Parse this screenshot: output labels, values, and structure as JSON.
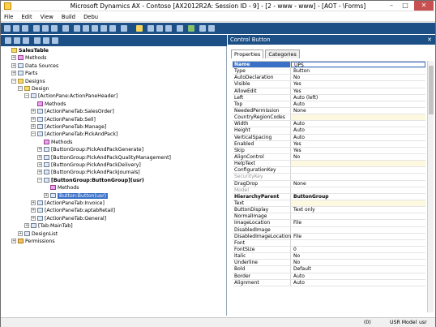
{
  "window": {
    "title": "Microsoft Dynamics AX - Contoso [AX2012R2A: Session ID - 9] - [2 - www - www] - [AOT - \\Forms]",
    "minimize": "–",
    "maximize": "□",
    "close": "✕"
  },
  "menu": [
    "File",
    "Edit",
    "View",
    "Build",
    "Debu"
  ],
  "tree": [
    {
      "label": "SalesTable",
      "icon": "form-icon",
      "bold": true,
      "indent": 0,
      "expander": ""
    },
    {
      "label": "Methods",
      "icon": "methods-icon",
      "indent": 1,
      "expander": "+"
    },
    {
      "label": "Data Sources",
      "icon": "datasource-icon",
      "indent": 1,
      "expander": "+"
    },
    {
      "label": "Parts",
      "icon": "parts-icon",
      "indent": 1,
      "expander": "+"
    },
    {
      "label": "Designs",
      "icon": "designs-icon",
      "indent": 1,
      "expander": "−"
    },
    {
      "label": "Design",
      "icon": "design-icon",
      "indent": 2,
      "expander": "−"
    },
    {
      "label": "[ActionPane:ActionPaneHeader]",
      "icon": "control-icon",
      "indent": 3,
      "expander": "−"
    },
    {
      "label": "Methods",
      "icon": "methods-icon",
      "indent": 4,
      "expander": ""
    },
    {
      "label": "[ActionPaneTab:SalesOrder]",
      "icon": "control-icon",
      "indent": 4,
      "expander": "+"
    },
    {
      "label": "[ActionPaneTab:Sell]",
      "icon": "control-icon",
      "indent": 4,
      "expander": "+"
    },
    {
      "label": "[ActionPaneTab:Manage]",
      "icon": "control-icon",
      "indent": 4,
      "expander": "+"
    },
    {
      "label": "[ActionPaneTab:PickAndPack]",
      "icon": "control-icon",
      "indent": 4,
      "expander": "−"
    },
    {
      "label": "Methods",
      "icon": "methods-icon",
      "indent": 5,
      "expander": ""
    },
    {
      "label": "[ButtonGroup:PickAndPackGenerate]",
      "icon": "control-icon",
      "indent": 5,
      "expander": "+"
    },
    {
      "label": "[ButtonGroup:PickAndPackQualityManagement]",
      "icon": "control-icon",
      "indent": 5,
      "expander": "+"
    },
    {
      "label": "[ButtonGroup:PickAndPackDelivery]",
      "icon": "control-icon",
      "indent": 5,
      "expander": "+"
    },
    {
      "label": "[ButtonGroup:PickAndPackJournals]",
      "icon": "control-icon",
      "indent": 5,
      "expander": "+"
    },
    {
      "label": "[ButtonGroup:ButtonGroup](usr)",
      "icon": "control-icon",
      "bold": true,
      "indent": 5,
      "expander": "−"
    },
    {
      "label": "Methods",
      "icon": "methods-icon",
      "indent": 6,
      "expander": ""
    },
    {
      "label": "Button:Button(usr)",
      "icon": "button-icon",
      "indent": 6,
      "expander": "+",
      "selected": true
    },
    {
      "label": "[ActionPaneTab:Invoice]",
      "icon": "control-icon",
      "indent": 4,
      "expander": "+"
    },
    {
      "label": "[ActionPaneTab:aptabRetail]",
      "icon": "control-icon",
      "indent": 4,
      "expander": "+"
    },
    {
      "label": "[ActionPaneTab:General]",
      "icon": "control-icon",
      "indent": 4,
      "expander": "+"
    },
    {
      "label": "[Tab:MainTab]",
      "icon": "control-icon",
      "indent": 3,
      "expander": "+"
    },
    {
      "label": "DesignList",
      "icon": "designlist-icon",
      "indent": 2,
      "expander": "+"
    },
    {
      "label": "Permissions",
      "icon": "key-icon",
      "indent": 1,
      "expander": "+"
    }
  ],
  "properties_panel": {
    "title": "Control Button",
    "close": "✕",
    "tabs": [
      "Properties",
      "Categories"
    ],
    "rows": [
      {
        "name": "Name",
        "value": "UPS",
        "style": "selrow"
      },
      {
        "name": "Type",
        "value": "Button"
      },
      {
        "name": "AutoDeclaration",
        "value": "No"
      },
      {
        "name": "Visible",
        "value": "Yes"
      },
      {
        "name": "AllowEdit",
        "value": "Yes"
      },
      {
        "name": "Left",
        "value": "Auto (left)"
      },
      {
        "name": "Top",
        "value": "Auto"
      },
      {
        "name": "NeededPermission",
        "value": "None"
      },
      {
        "name": "CountryRegionCodes",
        "value": "",
        "style": "yellow"
      },
      {
        "name": "Width",
        "value": "Auto"
      },
      {
        "name": "Height",
        "value": "Auto"
      },
      {
        "name": "VerticalSpacing",
        "value": "Auto"
      },
      {
        "name": "Enabled",
        "value": "Yes"
      },
      {
        "name": "Skip",
        "value": "Yes"
      },
      {
        "name": "AlignControl",
        "value": "No"
      },
      {
        "name": "HelpText",
        "value": "",
        "style": "yellow"
      },
      {
        "name": "ConfigurationKey",
        "value": ""
      },
      {
        "name": "SecurityKey",
        "value": "",
        "style": "grey"
      },
      {
        "name": "DragDrop",
        "value": "None"
      },
      {
        "name": "Model",
        "value": "",
        "style": "grey"
      },
      {
        "name": "HierarchyParent",
        "value": "ButtonGroup",
        "style": "bold"
      },
      {
        "name": "Text",
        "value": "",
        "style": "yellow"
      },
      {
        "name": "ButtonDisplay",
        "value": "Text only"
      },
      {
        "name": "NormalImage",
        "value": ""
      },
      {
        "name": "ImageLocation",
        "value": "File"
      },
      {
        "name": "DisabledImage",
        "value": ""
      },
      {
        "name": "DisabledImageLocation",
        "value": "File"
      },
      {
        "name": "Font",
        "value": ""
      },
      {
        "name": "FontSize",
        "value": "0"
      },
      {
        "name": "Italic",
        "value": "No"
      },
      {
        "name": "Underline",
        "value": "No"
      },
      {
        "name": "Bold",
        "value": "Default"
      },
      {
        "name": "Border",
        "value": "Auto"
      },
      {
        "name": "Alignment",
        "value": "Auto"
      }
    ]
  },
  "status": {
    "alerts": "(0)",
    "model": "USR Model",
    "user": "usr"
  },
  "colors": {
    "toolbar_blue": "#1b4f86",
    "selection": "#3a71c7",
    "close_red": "#c75050"
  }
}
